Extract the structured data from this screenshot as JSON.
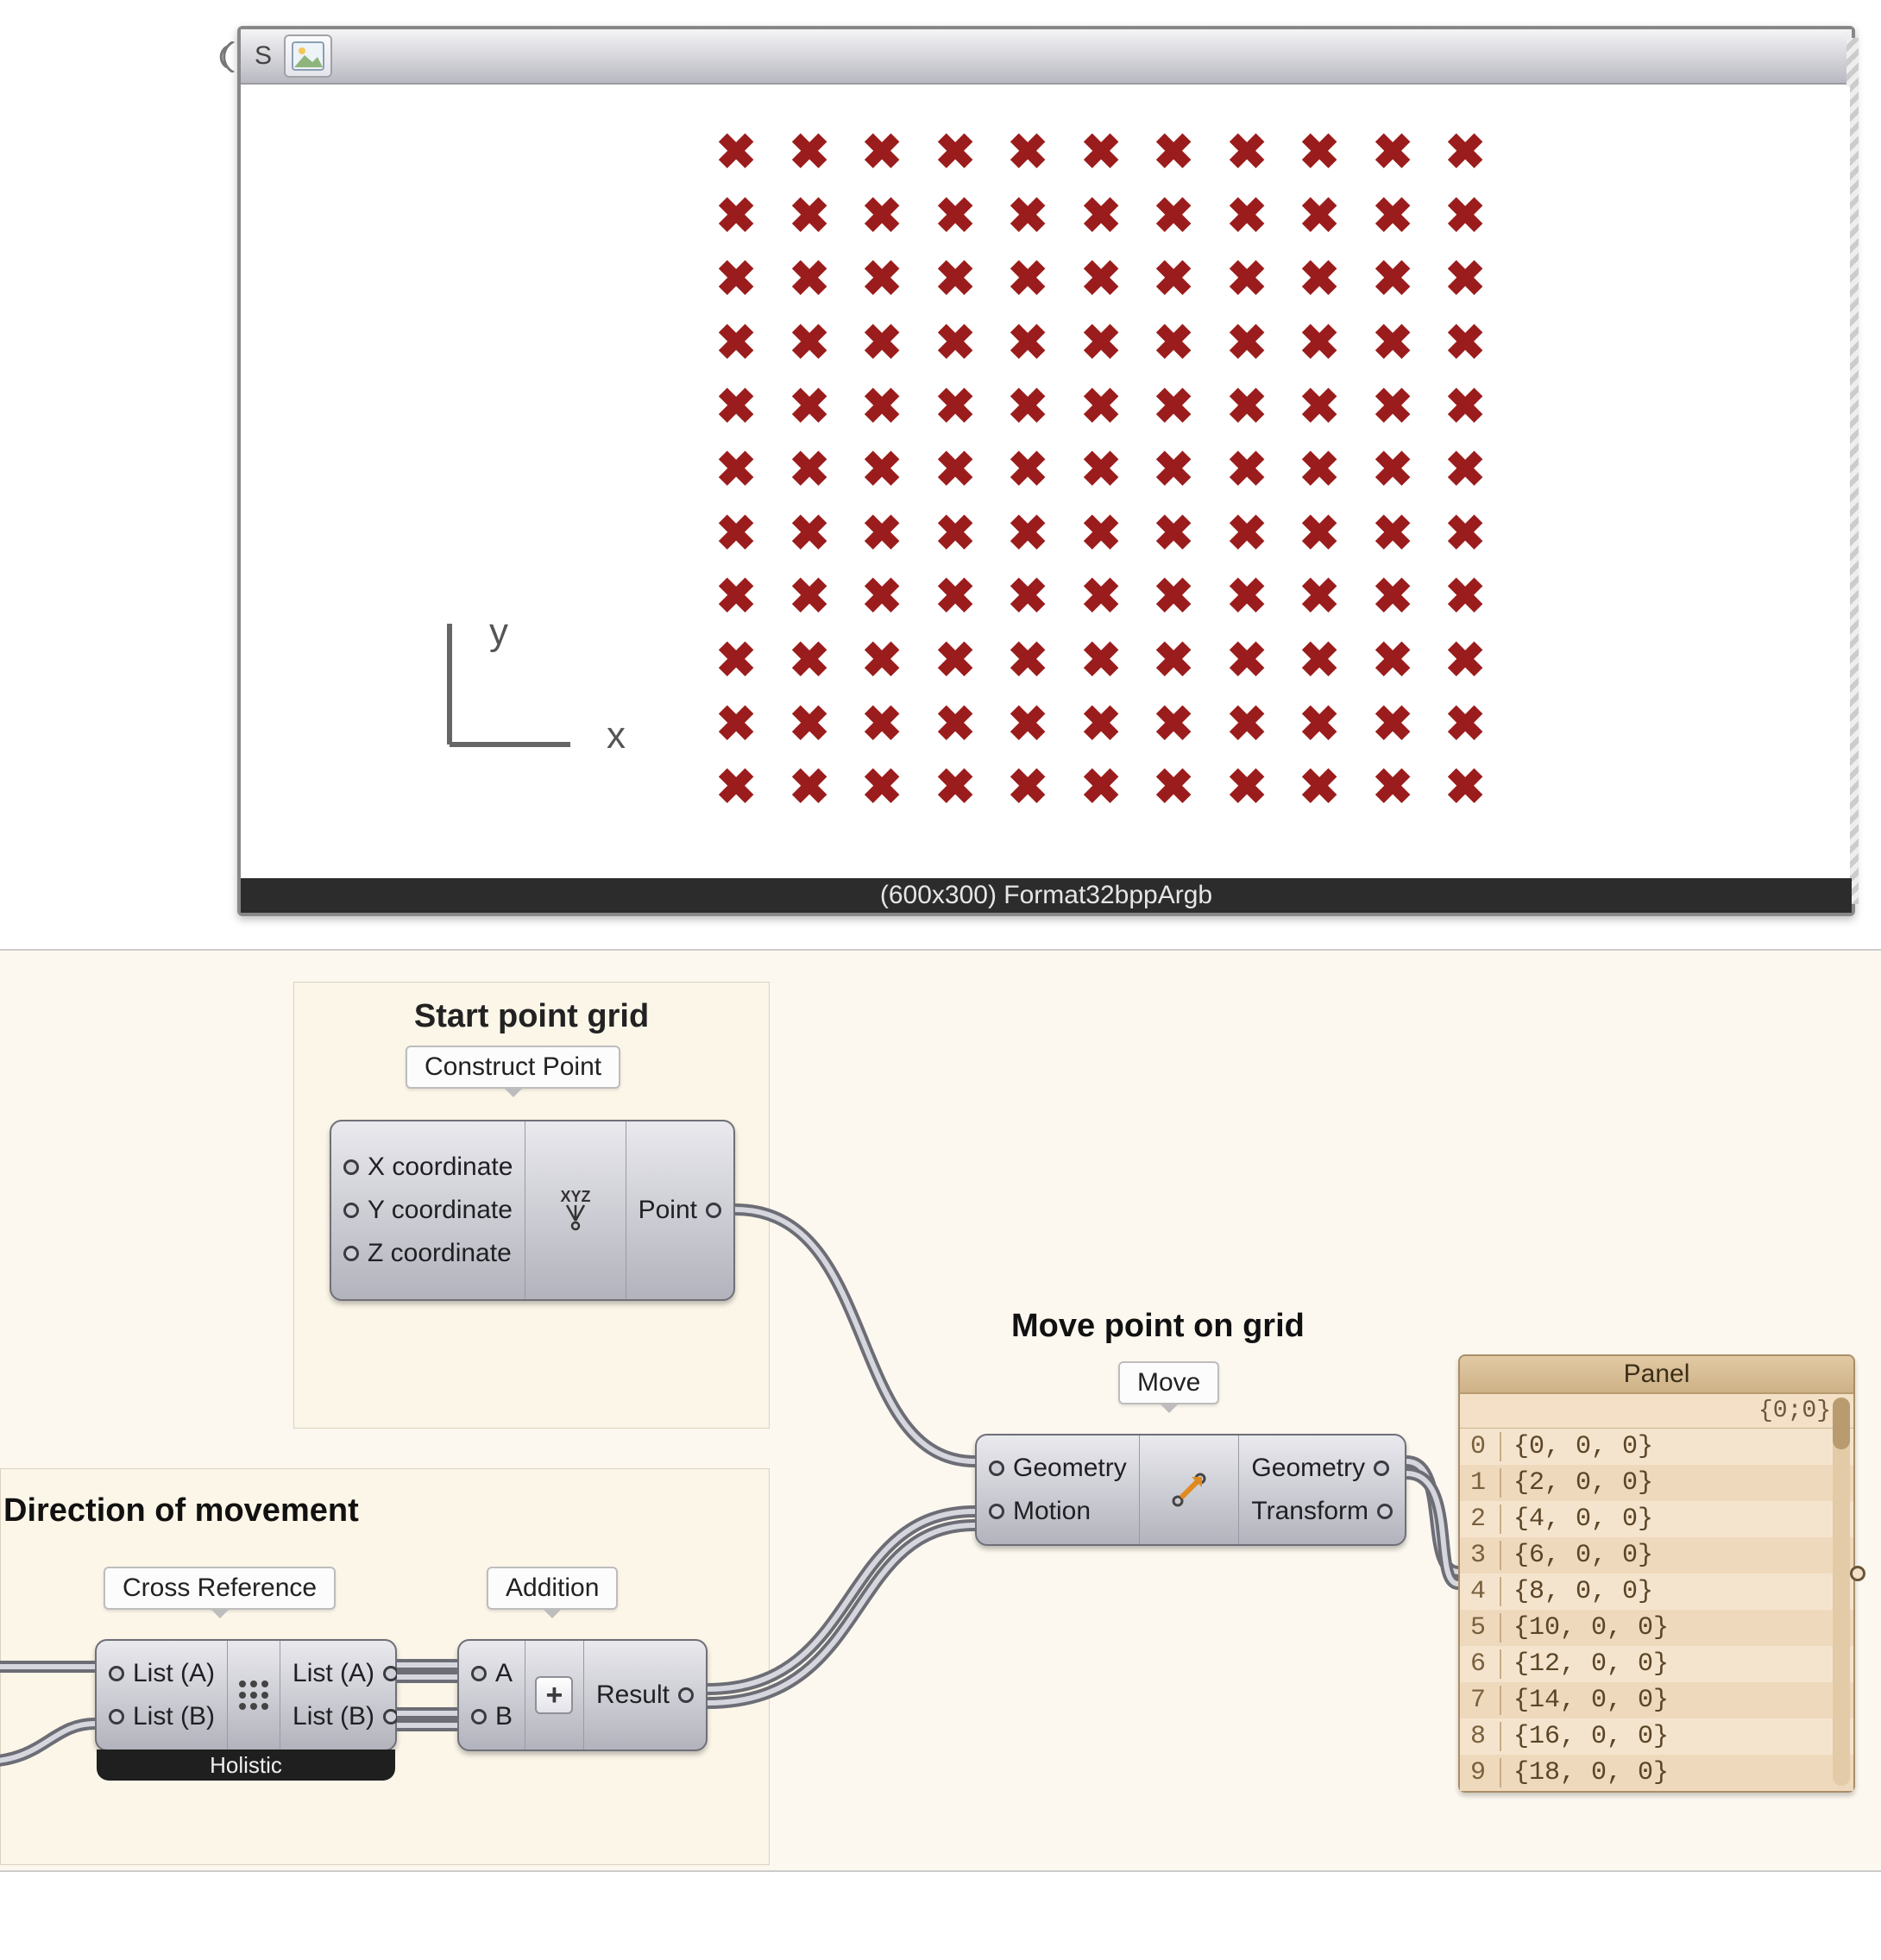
{
  "preview": {
    "titlebar_s": "S",
    "status": "(600x300) Format32bppArgb",
    "axis_y": "y",
    "axis_x": "x",
    "grid_rows": 11,
    "grid_cols": 11
  },
  "groups": {
    "start_grid": {
      "title": "Start point grid"
    },
    "direction": {
      "title": "Direction of movement"
    },
    "move": {
      "title": "Move point on grid"
    }
  },
  "labels": {
    "construct_point": "Construct Point",
    "cross_reference": "Cross Reference",
    "addition": "Addition",
    "move": "Move"
  },
  "nodes": {
    "construct_point": {
      "inputs": [
        "X coordinate",
        "Y coordinate",
        "Z coordinate"
      ],
      "outputs": [
        "Point"
      ],
      "icon_text": "XYZ"
    },
    "cross_ref": {
      "inputs": [
        "List (A)",
        "List (B)"
      ],
      "outputs": [
        "List (A)",
        "List (B)"
      ],
      "footer": "Holistic"
    },
    "addition": {
      "inputs": [
        "A",
        "B"
      ],
      "outputs": [
        "Result"
      ]
    },
    "move": {
      "inputs": [
        "Geometry",
        "Motion"
      ],
      "outputs": [
        "Geometry",
        "Transform"
      ]
    }
  },
  "panel": {
    "title": "Panel",
    "path": "{0;0}",
    "rows": [
      {
        "idx": "0",
        "val": "{0, 0, 0}"
      },
      {
        "idx": "1",
        "val": "{2, 0, 0}"
      },
      {
        "idx": "2",
        "val": "{4, 0, 0}"
      },
      {
        "idx": "3",
        "val": "{6, 0, 0}"
      },
      {
        "idx": "4",
        "val": "{8, 0, 0}"
      },
      {
        "idx": "5",
        "val": "{10, 0, 0}"
      },
      {
        "idx": "6",
        "val": "{12, 0, 0}"
      },
      {
        "idx": "7",
        "val": "{14, 0, 0}"
      },
      {
        "idx": "8",
        "val": "{16, 0, 0}"
      },
      {
        "idx": "9",
        "val": "{18, 0, 0}"
      }
    ]
  }
}
